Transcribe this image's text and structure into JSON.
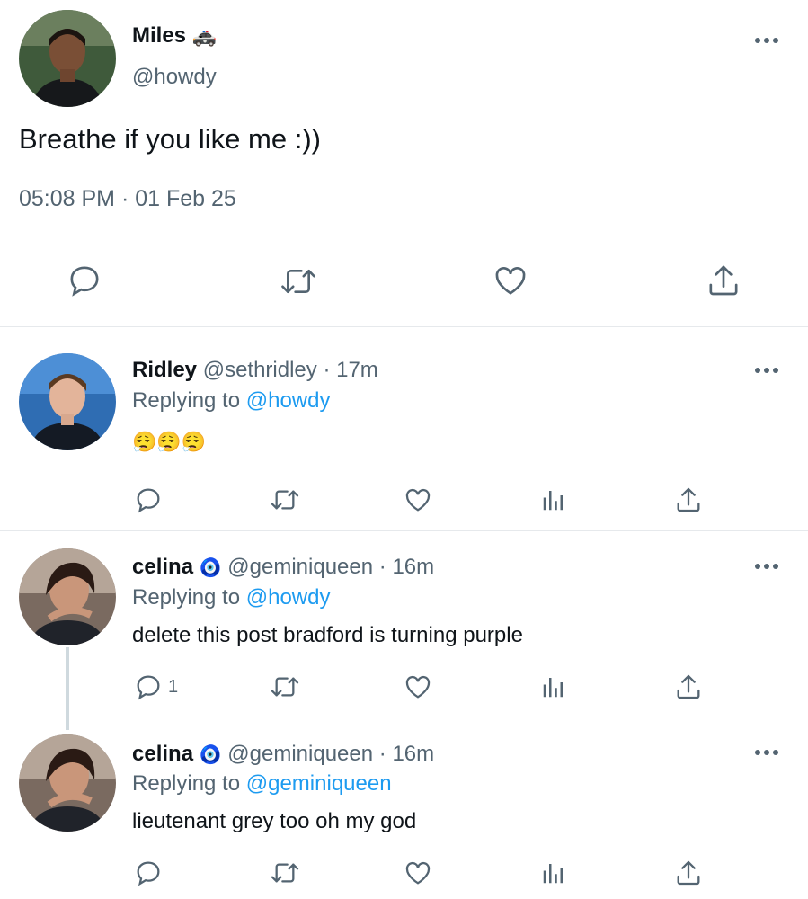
{
  "main_tweet": {
    "name": "Miles",
    "name_emoji": "🚓",
    "handle": "@howdy",
    "text": "Breathe if you like me :))",
    "timestamp": "05:08 PM · 01 Feb 25"
  },
  "replies": [
    {
      "name": "Ridley",
      "handle": "@sethridley",
      "time": "· 17m",
      "replying_prefix": "Replying to",
      "replying_to": "@howdy",
      "text": "😮‍💨😮‍💨😮‍💨",
      "reply_count": ""
    },
    {
      "name": "celina",
      "name_emoji": "🧿",
      "handle": "@geminiqueen",
      "time": "· 16m",
      "replying_prefix": "Replying to",
      "replying_to": "@howdy",
      "text": "delete this post bradford is turning purple",
      "reply_count": "1"
    },
    {
      "name": "celina",
      "name_emoji": "🧿",
      "handle": "@geminiqueen",
      "time": "· 16m",
      "replying_prefix": "Replying to",
      "replying_to": "@geminiqueen",
      "text": "lieutenant grey too oh my god",
      "reply_count": ""
    }
  ],
  "colors": {
    "text": "#0f1419",
    "secondary": "#536471",
    "link": "#1d9bf0",
    "divider": "#e6e9ec"
  },
  "icons": [
    "reply-icon",
    "retweet-icon",
    "like-icon",
    "views-icon",
    "share-icon",
    "more-icon"
  ]
}
